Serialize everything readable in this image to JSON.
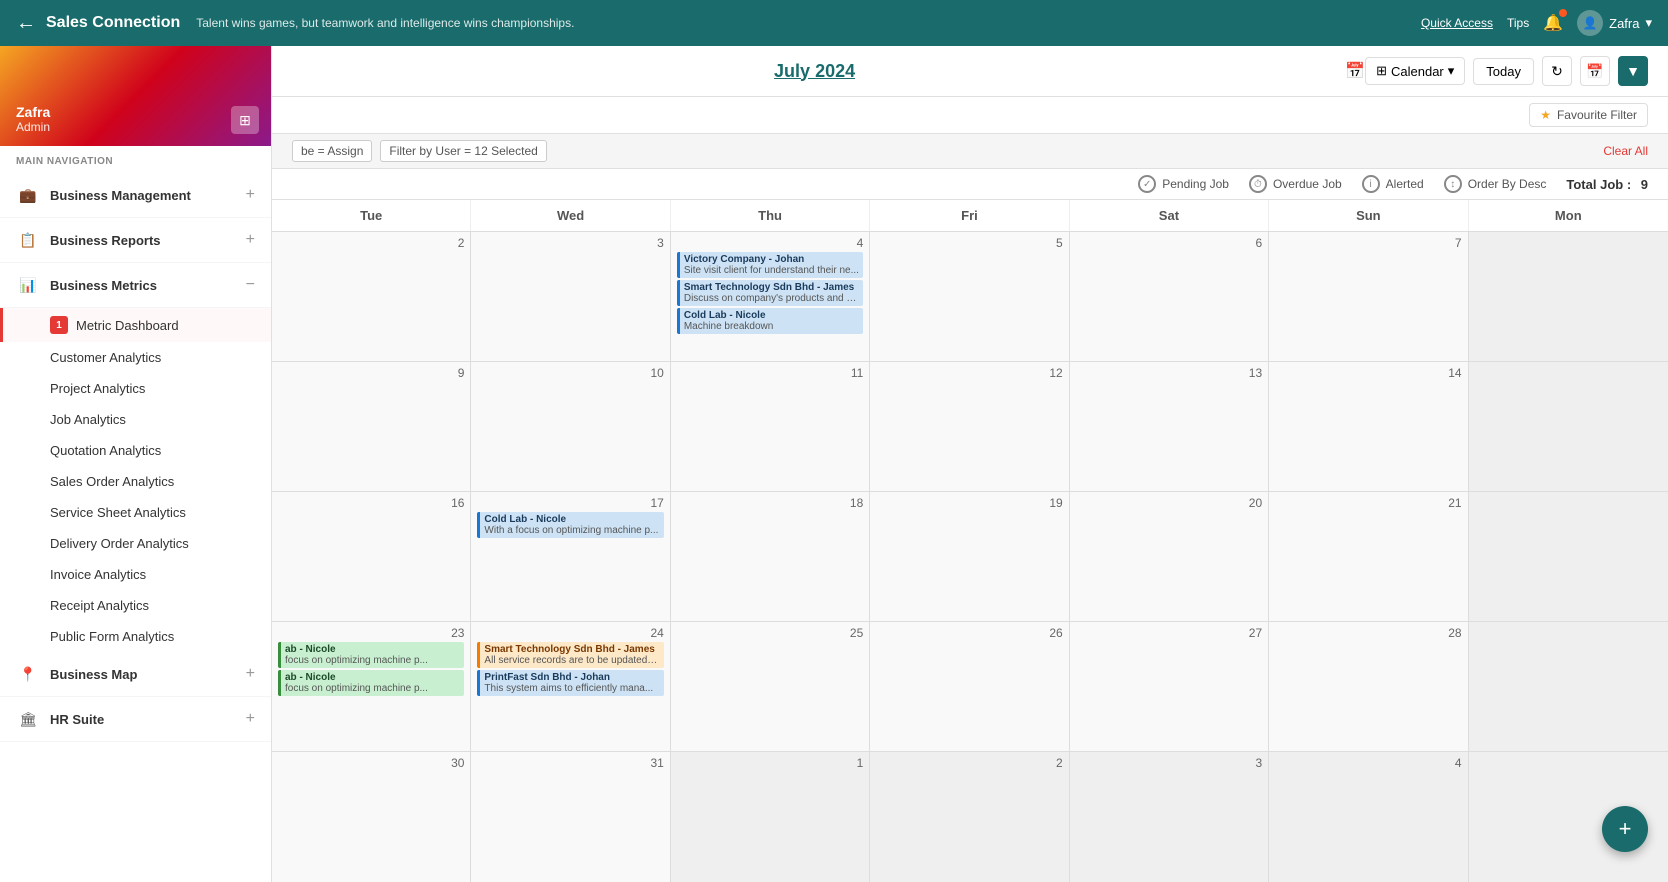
{
  "topNav": {
    "backLabel": "←",
    "title": "Sales Connection",
    "tagline": "Talent wins games, but teamwork and intelligence wins championships.",
    "quickAccess": "Quick Access",
    "tips": "Tips",
    "userName": "Zafra",
    "userDropdown": "▾"
  },
  "sidebar": {
    "userName": "Zafra",
    "userRole": "Admin",
    "navLabel": "MAIN NAVIGATION",
    "items": [
      {
        "id": "business-management",
        "icon": "💼",
        "label": "Business Management",
        "toggle": "+"
      },
      {
        "id": "business-reports",
        "icon": "📋",
        "label": "Business Reports",
        "toggle": "+"
      },
      {
        "id": "business-metrics",
        "icon": "📊",
        "label": "Business Metrics",
        "toggle": "−"
      },
      {
        "id": "business-map",
        "icon": "📍",
        "label": "Business Map",
        "toggle": "+"
      },
      {
        "id": "hr-suite",
        "icon": "🏛",
        "label": "HR Suite",
        "toggle": "+"
      }
    ],
    "metricsSubItems": [
      {
        "id": "metric-dashboard",
        "label": "Metric Dashboard",
        "badge": "1",
        "highlighted": true
      },
      {
        "id": "customer-analytics",
        "label": "Customer Analytics",
        "highlighted": false
      },
      {
        "id": "project-analytics",
        "label": "Project Analytics",
        "highlighted": false
      },
      {
        "id": "job-analytics",
        "label": "Job Analytics",
        "highlighted": false
      },
      {
        "id": "quotation-analytics",
        "label": "Quotation Analytics",
        "highlighted": false
      },
      {
        "id": "sales-order-analytics",
        "label": "Sales Order Analytics",
        "highlighted": false
      },
      {
        "id": "service-sheet-analytics",
        "label": "Service Sheet Analytics",
        "highlighted": false
      },
      {
        "id": "delivery-order-analytics",
        "label": "Delivery Order Analytics",
        "highlighted": false
      },
      {
        "id": "invoice-analytics",
        "label": "Invoice Analytics",
        "highlighted": false
      },
      {
        "id": "receipt-analytics",
        "label": "Receipt Analytics",
        "highlighted": false
      },
      {
        "id": "public-form-analytics",
        "label": "Public Form Analytics",
        "highlighted": false
      }
    ]
  },
  "calendar": {
    "title": "July 2024",
    "viewLabel": "Calendar",
    "viewIcon": "▾",
    "todayBtn": "Today",
    "refreshIcon": "↻",
    "scheduleIcon": "📅",
    "filterIcon": "▼",
    "favouriteFilter": "Favourite Filter",
    "filterTags": [
      "be = Assign",
      "Filter by User = 12 Selected"
    ],
    "clearAll": "Clear All",
    "statusItems": [
      {
        "id": "pending-job",
        "icon": "✓",
        "label": "Pending Job"
      },
      {
        "id": "overdue-job",
        "icon": "⏱",
        "label": "Overdue Job"
      },
      {
        "id": "alerted",
        "icon": "i",
        "label": "Alerted"
      },
      {
        "id": "order-by-desc",
        "icon": "↕",
        "label": "Order By Desc"
      }
    ],
    "totalJobLabel": "Total Job :",
    "totalJobValue": "9",
    "dayHeaders": [
      "Tue",
      "Wed",
      "Thu",
      "Fri",
      "Sat",
      "Sun",
      "Mon"
    ],
    "weeks": [
      {
        "days": [
          {
            "num": "2",
            "otherMonth": false,
            "today": false,
            "events": []
          },
          {
            "num": "3",
            "otherMonth": false,
            "today": false,
            "events": []
          },
          {
            "num": "4",
            "otherMonth": false,
            "today": false,
            "events": [
              {
                "title": "Victory Company - Johan",
                "desc": "Site visit client for understand their ne...",
                "color": "blue"
              },
              {
                "title": "Smart Technology Sdn Bhd - James",
                "desc": "Discuss on company's products and s...",
                "color": "blue"
              },
              {
                "title": "Cold Lab - Nicole",
                "desc": "Machine breakdown",
                "color": "blue"
              }
            ]
          },
          {
            "num": "5",
            "otherMonth": false,
            "today": false,
            "events": []
          },
          {
            "num": "6",
            "otherMonth": false,
            "today": false,
            "events": []
          },
          {
            "num": "7",
            "otherMonth": false,
            "today": false,
            "events": []
          },
          {
            "num": "",
            "otherMonth": true,
            "today": false,
            "events": []
          }
        ]
      },
      {
        "days": [
          {
            "num": "9",
            "otherMonth": false,
            "today": false,
            "events": []
          },
          {
            "num": "10",
            "otherMonth": false,
            "today": false,
            "events": []
          },
          {
            "num": "11",
            "otherMonth": false,
            "today": false,
            "events": []
          },
          {
            "num": "12",
            "otherMonth": false,
            "today": false,
            "events": []
          },
          {
            "num": "13",
            "otherMonth": false,
            "today": false,
            "events": []
          },
          {
            "num": "14",
            "otherMonth": false,
            "today": false,
            "events": []
          },
          {
            "num": "",
            "otherMonth": true,
            "today": false,
            "events": []
          }
        ]
      },
      {
        "days": [
          {
            "num": "16",
            "otherMonth": false,
            "today": false,
            "events": []
          },
          {
            "num": "17",
            "otherMonth": false,
            "today": false,
            "events": [
              {
                "title": "Cold Lab - Nicole",
                "desc": "With a focus on optimizing machine p...",
                "color": "blue"
              }
            ]
          },
          {
            "num": "18",
            "otherMonth": false,
            "today": false,
            "events": []
          },
          {
            "num": "19",
            "otherMonth": false,
            "today": false,
            "events": []
          },
          {
            "num": "20",
            "otherMonth": false,
            "today": false,
            "events": []
          },
          {
            "num": "21",
            "otherMonth": false,
            "today": false,
            "events": []
          },
          {
            "num": "",
            "otherMonth": true,
            "today": false,
            "events": []
          }
        ]
      },
      {
        "days": [
          {
            "num": "23",
            "otherMonth": false,
            "today": false,
            "events": [
              {
                "title": "ab - Nicole",
                "desc": "focus on optimizing machine p...",
                "color": "green"
              },
              {
                "title": "ab - Nicole",
                "desc": "focus on optimizing machine p...",
                "color": "green"
              }
            ]
          },
          {
            "num": "24",
            "otherMonth": false,
            "today": false,
            "events": [
              {
                "title": "Smart Technology Sdn Bhd - James",
                "desc": "All service records are to be updated i...",
                "color": "orange"
              },
              {
                "title": "PrintFast Sdn Bhd - Johan",
                "desc": "This system aims to efficiently mana...",
                "color": "blue"
              }
            ]
          },
          {
            "num": "25",
            "otherMonth": false,
            "today": false,
            "events": []
          },
          {
            "num": "26",
            "otherMonth": false,
            "today": false,
            "events": []
          },
          {
            "num": "27",
            "otherMonth": false,
            "today": false,
            "events": []
          },
          {
            "num": "28",
            "otherMonth": false,
            "today": false,
            "events": []
          },
          {
            "num": "",
            "otherMonth": true,
            "today": false,
            "events": []
          }
        ]
      },
      {
        "days": [
          {
            "num": "30",
            "otherMonth": false,
            "today": false,
            "events": []
          },
          {
            "num": "31",
            "otherMonth": false,
            "today": false,
            "events": []
          },
          {
            "num": "1",
            "otherMonth": true,
            "today": false,
            "events": []
          },
          {
            "num": "2",
            "otherMonth": true,
            "today": false,
            "events": []
          },
          {
            "num": "3",
            "otherMonth": true,
            "today": false,
            "events": []
          },
          {
            "num": "4",
            "otherMonth": true,
            "today": false,
            "events": []
          },
          {
            "num": "",
            "otherMonth": true,
            "today": false,
            "events": []
          }
        ]
      }
    ]
  },
  "fab": {
    "icon": "+"
  }
}
